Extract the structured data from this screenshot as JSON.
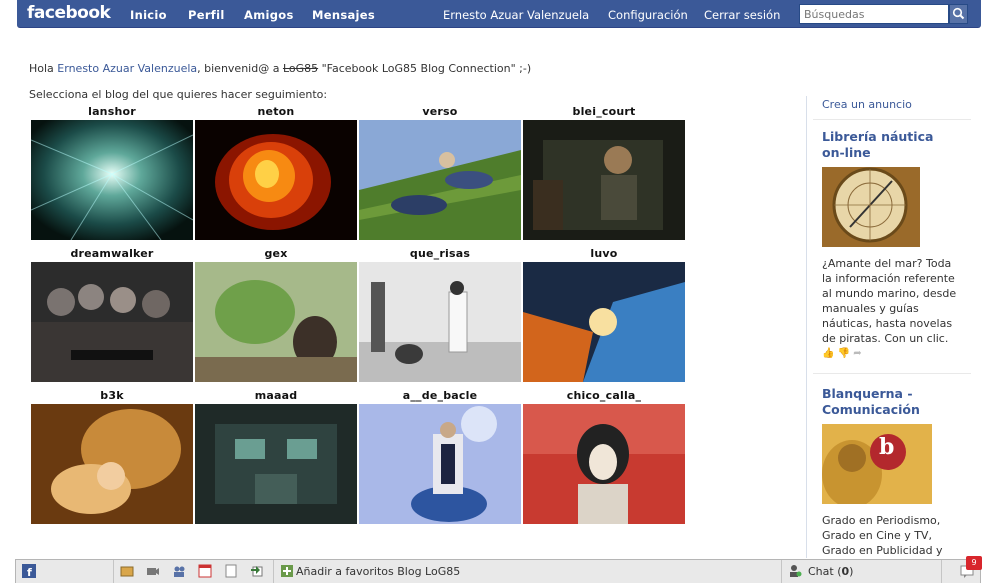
{
  "topbar": {
    "logo": "facebook",
    "nav": [
      "Inicio",
      "Perfil",
      "Amigos",
      "Mensajes"
    ],
    "user": "Ernesto Azuar Valenzuela",
    "settings": "Configuración",
    "logout": "Cerrar sesión",
    "search_placeholder": "Búsquedas"
  },
  "main": {
    "greet_prefix": "Hola ",
    "user_link": "Ernesto Azuar Valenzuela",
    "greet_middle": ", bienvenid@ a ",
    "struck": "LoG85",
    "greet_suffix": " \"Facebook LoG85 Blog Connection\" ;-)",
    "prompt": "Selecciona el blog del que quieres hacer seguimiento:",
    "blogs": [
      "lanshor",
      "neton",
      "verso",
      "blei_court",
      "dreamwalker",
      "gex",
      "que_risas",
      "luvo",
      "b3k",
      "maaad",
      "a__de_bacle",
      "chico_calla_"
    ]
  },
  "sidebar": {
    "create_ad": "Crea un anuncio",
    "ads": [
      {
        "title_line1": "Librería náutica",
        "title_line2": "on-line",
        "text_lines": [
          "¿Amante del mar? Toda",
          "la información referente",
          "al mundo marino, desde",
          "manuales y guías",
          "náuticas, hasta novelas",
          "de piratas. Con un clic."
        ]
      },
      {
        "title_line1": "Blanquerna -",
        "title_line2": "Comunicación",
        "logo_letter": "b",
        "text_lines": [
          "Grado en Periodismo,",
          "Grado en Cine y TV,",
          "Grado en Publicidad y"
        ]
      }
    ]
  },
  "bottombar": {
    "bookmark": "Añadir a favoritos Blog LoG85",
    "chat_label": "Chat (",
    "chat_count": "0",
    "chat_close": ")",
    "notif_count": "9"
  },
  "colors": {
    "brand": "#3b5998",
    "badge": "#d8262c"
  }
}
